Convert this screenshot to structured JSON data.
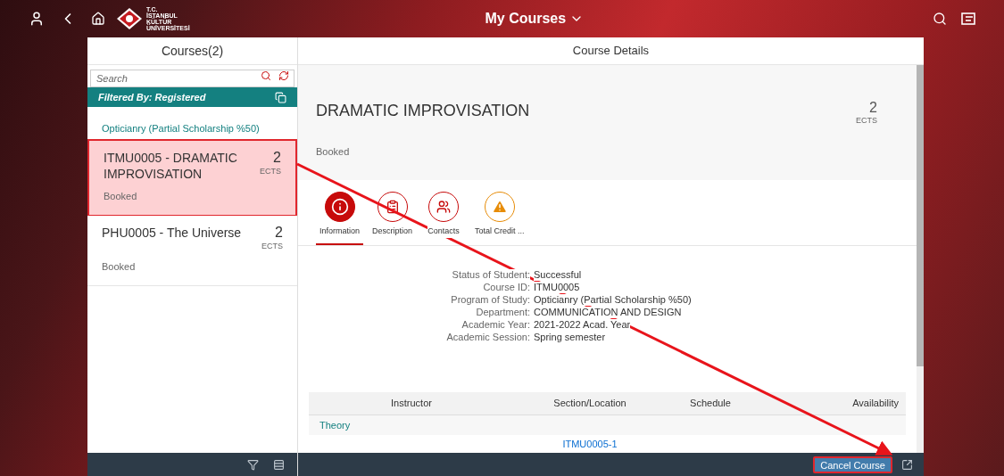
{
  "shell": {
    "title": "My Courses",
    "logo_lines": [
      "T.C.",
      "İSTANBUL",
      "KÜLTÜR",
      "ÜNİVERSİTESİ"
    ]
  },
  "master": {
    "title": "Courses(2)",
    "search": {
      "placeholder": "Search"
    },
    "filter": "Filtered By: Registered",
    "group": "Opticianry (Partial Scholarship %50)",
    "items": [
      {
        "title": "ITMU0005 - DRAMATIC IMPROVISATION",
        "credits": "2",
        "unit": "ECTS",
        "status": "Booked",
        "selected": true
      },
      {
        "title": "PHU0005 - The Universe",
        "credits": "2",
        "unit": "ECTS",
        "status": "Booked",
        "selected": false
      }
    ]
  },
  "detail": {
    "title": "Course Details",
    "object": {
      "title": "DRAMATIC IMPROVISATION",
      "status": "Booked",
      "credits": "2",
      "unit": "ECTS"
    },
    "tabs": [
      {
        "label": "Information",
        "kind": "info",
        "selected": true
      },
      {
        "label": "Description",
        "kind": "description",
        "selected": false
      },
      {
        "label": "Contacts",
        "kind": "contacts",
        "selected": false
      },
      {
        "label": "Total Credit ...",
        "kind": "warning",
        "selected": false
      }
    ],
    "fields": [
      {
        "label": "Status of Student:",
        "value": "Successful"
      },
      {
        "label": "Course ID:",
        "value": "ITMU0005"
      },
      {
        "label": "Program of Study:",
        "value": "Opticianry (Partial Scholarship %50)"
      },
      {
        "label": "Department:",
        "value": "COMMUNICATION AND DESIGN"
      },
      {
        "label": "Academic Year:",
        "value": "2021-2022 Acad. Year"
      },
      {
        "label": "Academic Session:",
        "value": "Spring semester"
      }
    ],
    "table": {
      "columns": [
        "Instructor",
        "Section/Location",
        "Schedule",
        "Availability"
      ],
      "group": "Theory",
      "rows": [
        [
          "",
          "ITMU0005-1",
          "",
          ""
        ]
      ]
    },
    "footer": {
      "button": "Cancel Course"
    }
  }
}
